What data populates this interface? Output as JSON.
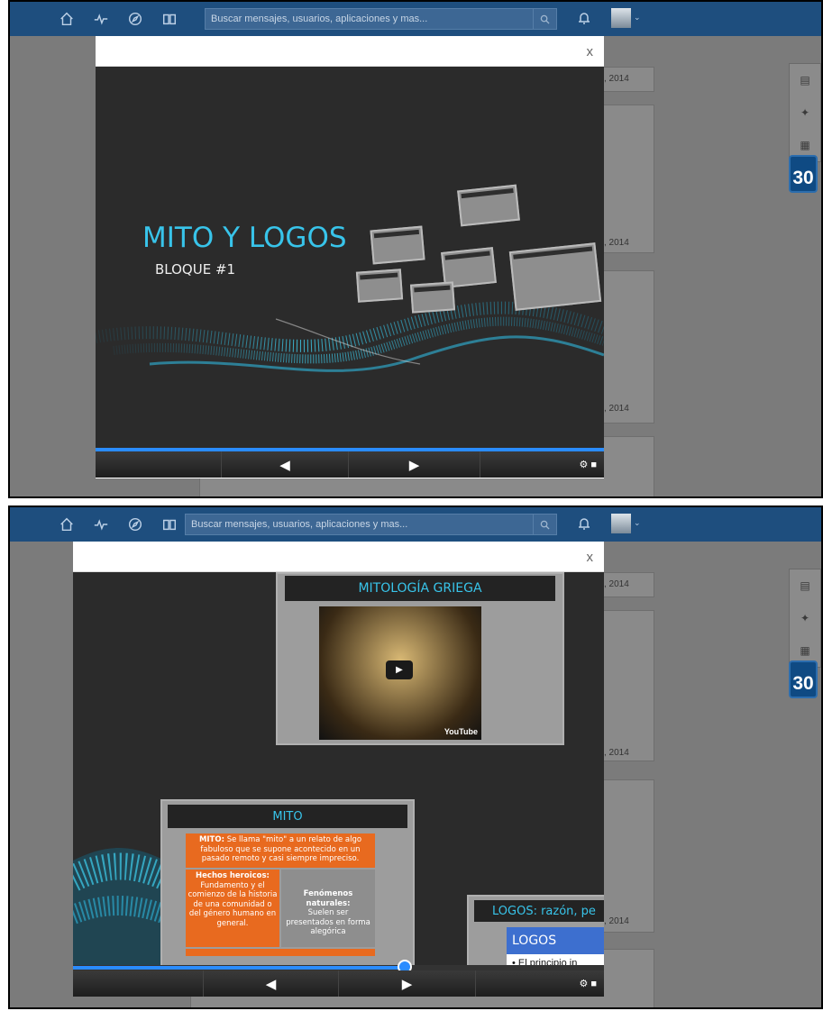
{
  "search": {
    "placeholder": "Buscar mensajes, usuarios, aplicaciones y mas..."
  },
  "feed": {
    "date_suffix": ", 2014"
  },
  "calendar": {
    "day": "30"
  },
  "modal": {
    "close": "x"
  },
  "slide1": {
    "title": "MITO Y LOGOS",
    "subtitle": "BLOQUE #1"
  },
  "slide2": {
    "mitologia_title": "MITOLOGÍA GRIEGA",
    "youtube_logo": "YouTube",
    "mito_title": "MITO",
    "mito_def_bold": "MITO:",
    "mito_def": "Se llama \"mito\" a un relato de algo fabuloso que se supone acontecido en un pasado remoto y casi siempre impreciso.",
    "hechos_title": "Hechos heroicos:",
    "hechos_text": "Fundamento y el comienzo de la historia de una comunidad o del género humano en general.",
    "fenomenos_title": "Fenómenos naturales:",
    "fenomenos_text": "Suelen ser presentados en forma alegórica",
    "logos_title": "LOGOS: razón, pe",
    "logos_box": "LOGOS",
    "logos_bullet": "• El principio in"
  },
  "progress": {
    "top_fraction": 1.0,
    "bottom_fraction": 0.64
  }
}
